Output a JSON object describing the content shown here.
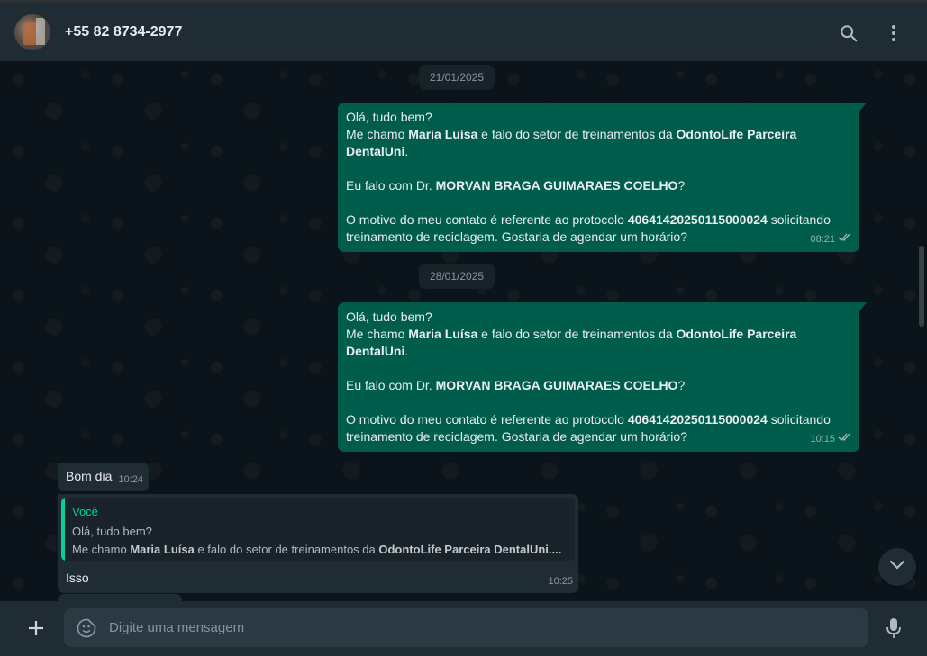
{
  "header": {
    "contact_name": "+55 82 8734-2977",
    "icons": [
      "search-icon",
      "menu-icon"
    ]
  },
  "messages": {
    "date1": "21/01/2025",
    "date2": "28/01/2025",
    "out": [
      {
        "l1": "Olá, tudo bem?",
        "l2_pre": "Me chamo ",
        "l2_name": "Maria Luísa",
        "l2_mid": " e falo do setor de treinamentos da ",
        "l2_company": "OdontoLife Parceira",
        "l3_company": "DentalUni",
        "l3_end": ".",
        "l5_pre": "Eu falo com Dr. ",
        "l5_doctor": "MORVAN BRAGA GUIMARAES COELHO",
        "l5_end": "?",
        "l7_pre": "O motivo do meu contato é referente ao protocolo ",
        "l7_protocol": "40641420250115000024",
        "l7_end": " solicitando",
        "l8": "treinamento de reciclagem. Gostaria de agendar um horário?",
        "time": "08:21"
      },
      {
        "l1": "Olá, tudo bem?",
        "l2_pre": "Me chamo ",
        "l2_name": "Maria Luísa",
        "l2_mid": " e falo do setor de treinamentos da ",
        "l2_company": "OdontoLife Parceira",
        "l3_company": "DentalUni",
        "l3_end": ".",
        "l5_pre": "Eu falo com Dr. ",
        "l5_doctor": "MORVAN BRAGA GUIMARAES COELHO",
        "l5_end": "?",
        "l7_pre": "O motivo do meu contato é referente ao protocolo ",
        "l7_protocol": "40641420250115000024",
        "l7_end": " solicitando",
        "l8": "treinamento de reciclagem. Gostaria de agendar um horário?",
        "time": "10:15"
      }
    ],
    "in1": {
      "text": "Bom dia",
      "time": "10:24"
    },
    "in2": {
      "quote_author": "Você",
      "quote_l1": "Olá, tudo bem?",
      "quote_l2_pre": "Me chamo ",
      "quote_l2_name": "Maria Luísa",
      "quote_l2_mid": " e falo do setor de treinamentos da ",
      "quote_l2_company": "OdontoLife Parceira DentalUni....",
      "text": "Isso",
      "time": "10:25"
    }
  },
  "composer": {
    "placeholder": "Digite uma mensagem"
  },
  "colors": {
    "outgoing": "#005c4b",
    "incoming": "#202c33",
    "accent": "#06cf9c"
  }
}
